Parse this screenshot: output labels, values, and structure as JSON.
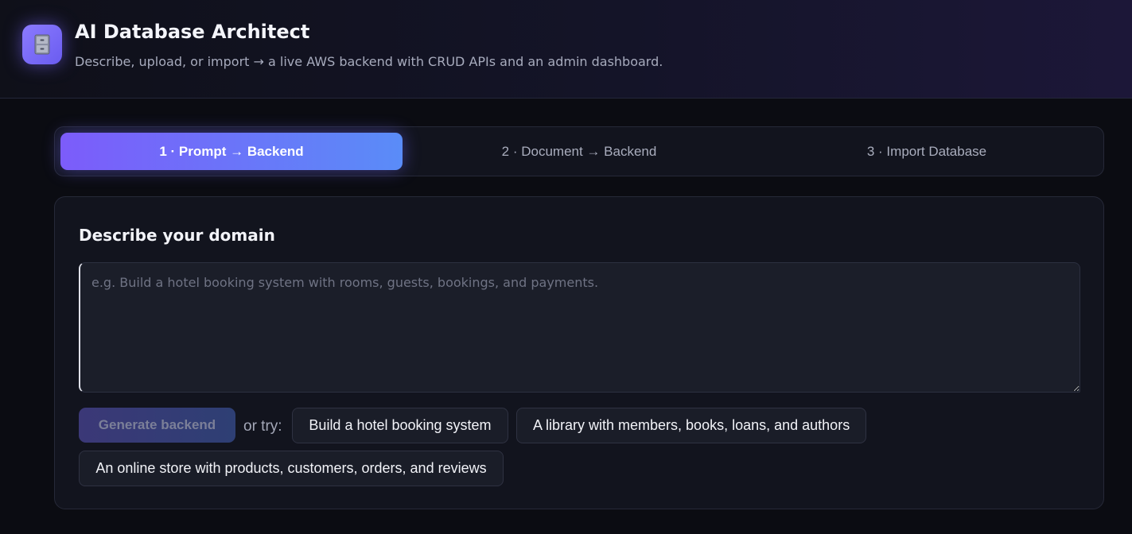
{
  "header": {
    "logo_icon": "file-cabinet-icon",
    "title": "AI Database Architect",
    "subtitle": "Describe, upload, or import → a live AWS backend with CRUD APIs and an admin dashboard."
  },
  "tabs": [
    {
      "label": "1 · Prompt → Backend",
      "active": true
    },
    {
      "label": "2 · Document → Backend",
      "active": false
    },
    {
      "label": "3 · Import Database",
      "active": false
    }
  ],
  "prompt_card": {
    "title": "Describe your domain",
    "input_value": "",
    "input_placeholder": "e.g. Build a hotel booking system with rooms, guests, bookings, and payments.",
    "generate_label": "Generate backend",
    "generate_disabled": true,
    "or_try_label": "or try:",
    "examples": [
      "Build a hotel booking system",
      "A library with members, books, loans, and authors",
      "An online store with products, customers, orders, and reviews"
    ]
  },
  "colors": {
    "background": "#0b0c12",
    "card": "#12141e",
    "accent_start": "#7c5cfa",
    "accent_end": "#5a8cf8"
  }
}
